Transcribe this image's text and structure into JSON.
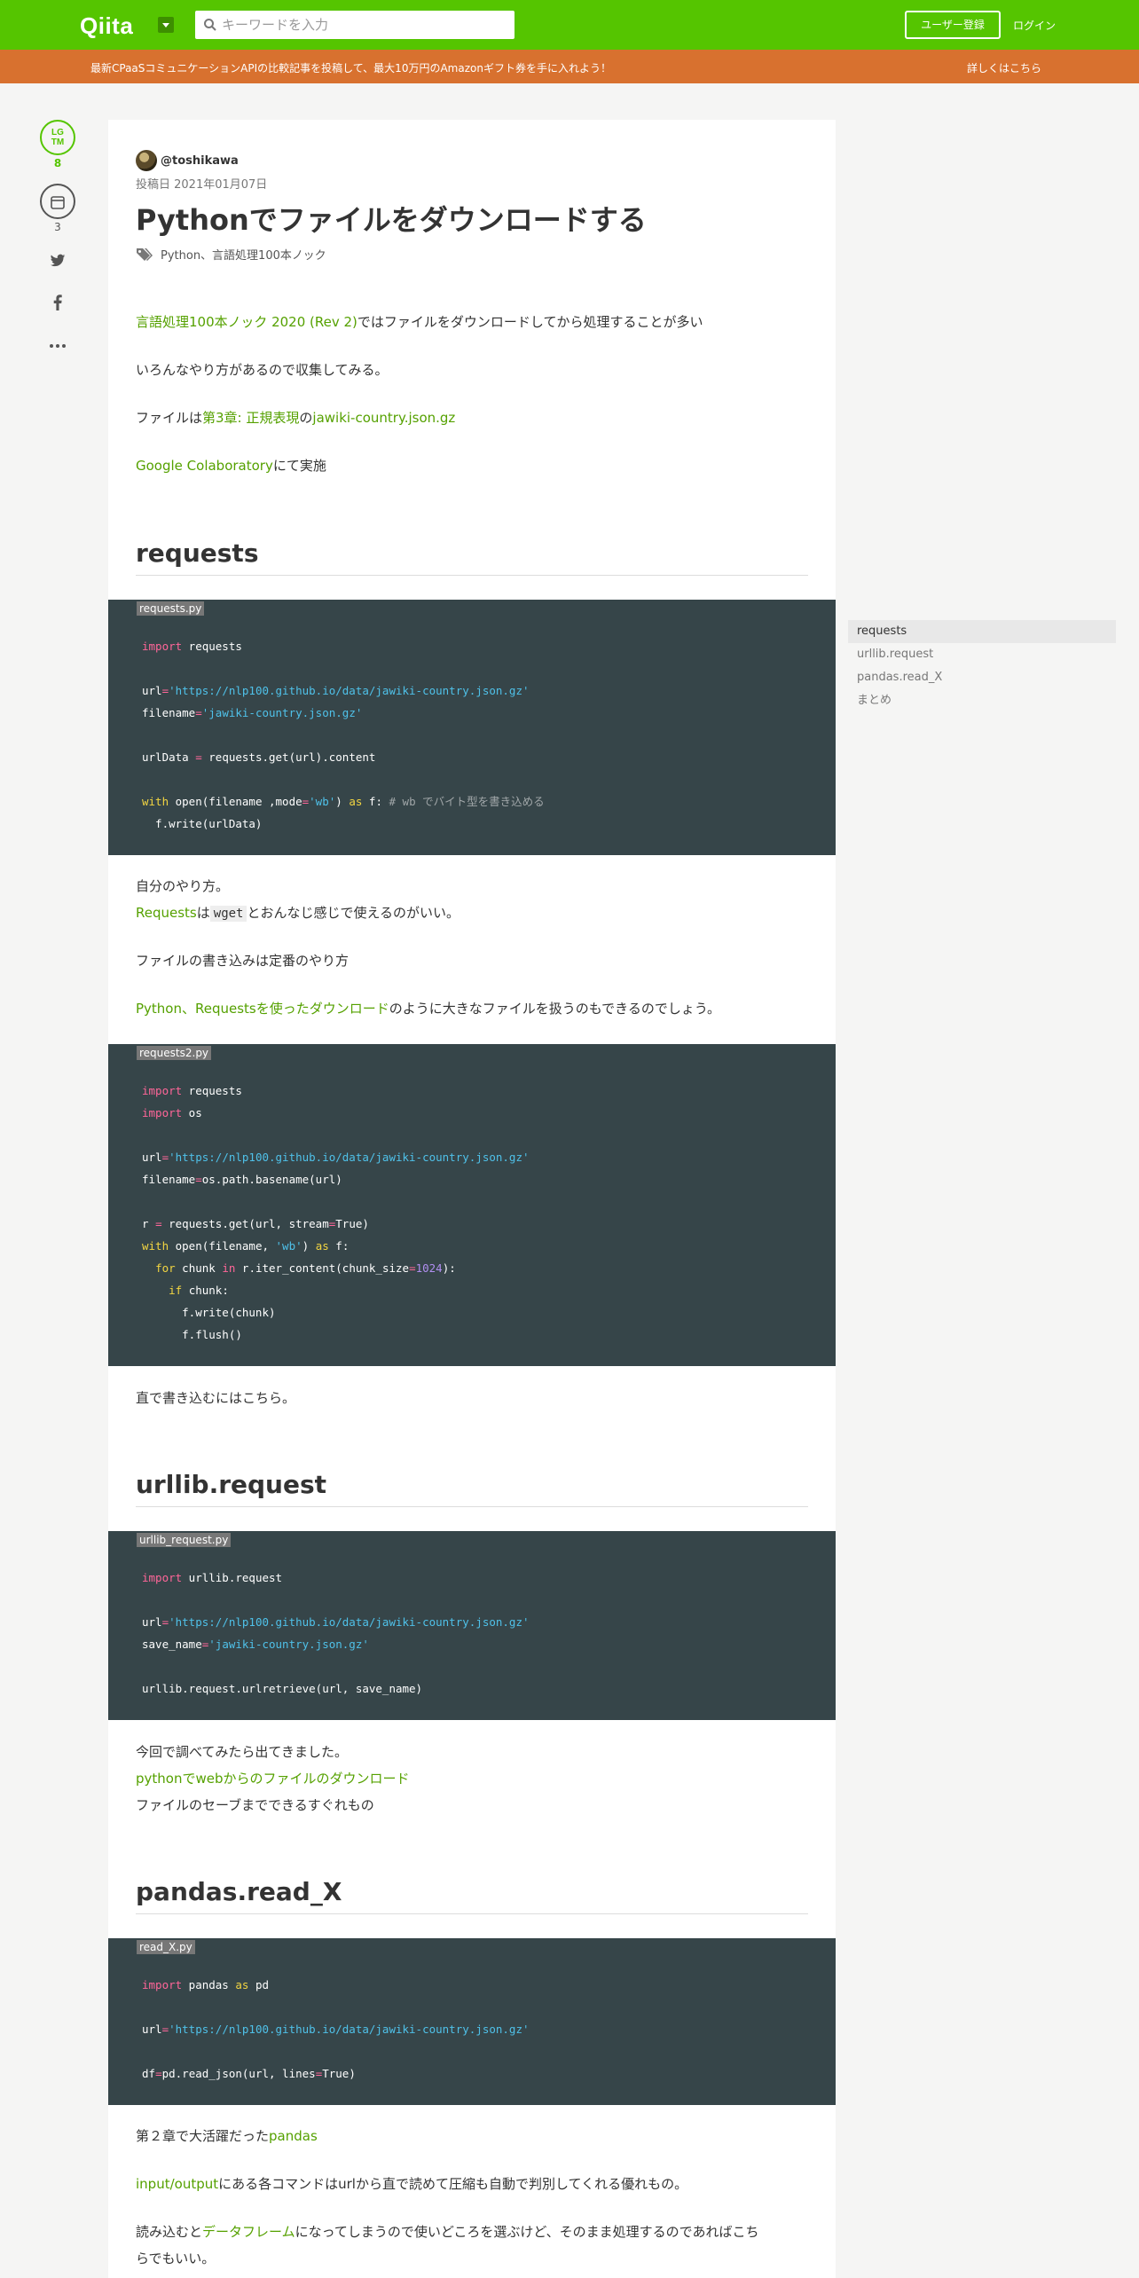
{
  "header": {
    "logo": "Qiita",
    "search_placeholder": "キーワードを入力",
    "signup": "ユーザー登録",
    "login": "ログイン"
  },
  "banner": {
    "text": "最新CPaaSコミュニケーションAPIの比較記事を投稿して、最大10万円のAmazonギフト券を手に入れよう！",
    "link": "詳しくはこちら"
  },
  "actions": {
    "lgtm_line1": "LG",
    "lgtm_line2": "TM",
    "lgtm_count": "8",
    "stock_count": "3"
  },
  "article": {
    "author": "@toshikawa",
    "date": "投稿日 2021年01月07日",
    "title": "Pythonでファイルをダウンロードする",
    "tags": "Python、言語処理100本ノック",
    "intro": {
      "p1_link": "言語処理100本ノック 2020 (Rev 2)",
      "p1_text": "ではファイルをダウンロードしてから処理することが多い",
      "p2": "いろんなやり方があるので収集してみる。",
      "p3_pre": "ファイルは",
      "p3_link1": "第3章: 正規表現",
      "p3_mid": "の",
      "p3_link2": "jawiki-country.json.gz",
      "p4_link": "Google Colaboratory",
      "p4_text": "にて実施"
    },
    "sec1": {
      "heading": "requests",
      "file1": "requests.py",
      "after1": "自分のやり方。",
      "after2_link": "Requests",
      "after2_mid": "は",
      "after2_code": "wget",
      "after2_text": "とおんなじ感じで使えるのがいい。",
      "after3": "ファイルの書き込みは定番のやり方",
      "after4_link": "Python、Requestsを使ったダウンロード",
      "after4_text": "のように大きなファイルを扱うのもできるのでしょう。",
      "file2": "requests2.py",
      "after5": "直で書き込むにはこちら。"
    },
    "sec2": {
      "heading": "urllib.request",
      "file": "urllib_request.py",
      "after1": "今回で調べてみたら出てきました。",
      "after2_link": "pythonでwebからのファイルのダウンロード",
      "after3": "ファイルのセーブまでできるすぐれもの"
    },
    "sec3": {
      "heading": "pandas.read_X",
      "file": "read_X.py",
      "after1_pre": "第２章で大活躍だった",
      "after1_link": "pandas",
      "after2_link": "input/output",
      "after2_text": "にある各コマンドはurlから直で読めて圧縮も自動で判別してくれる優れもの。",
      "after3_pre": "読み込むと",
      "after3_link": "データフレーム",
      "after3_text": "になってしまうので使いどころを選ぶけど、そのまま処理するのであればこち",
      "after3_line2": "らでもいい。"
    }
  },
  "toc": [
    "requests",
    "urllib.request",
    "pandas.read_X",
    "まとめ"
  ],
  "colors": {
    "brand": "#55c500",
    "banner": "#d8712f",
    "code_bg": "#364549",
    "link": "#55a100"
  }
}
